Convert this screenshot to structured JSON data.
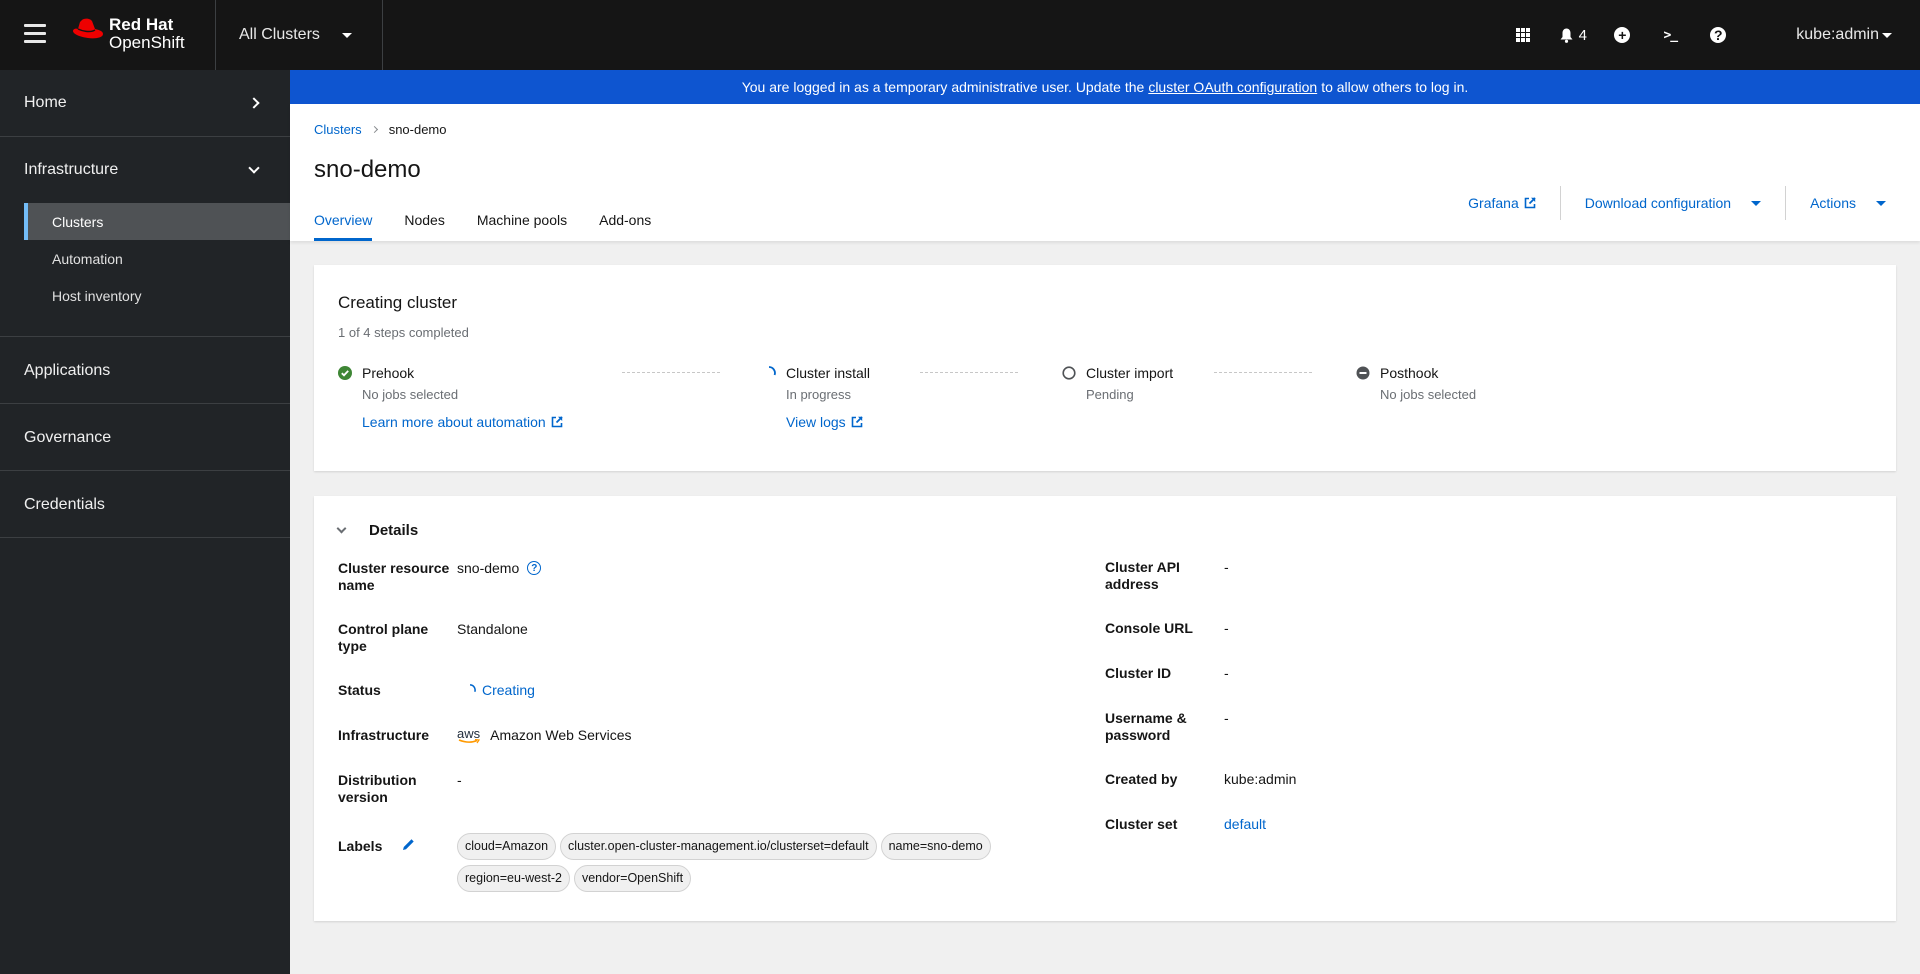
{
  "masthead": {
    "brand_line1": "Red Hat",
    "brand_line2": "OpenShift",
    "cluster_switcher": "All Clusters",
    "notifications_count": "4",
    "user": "kube:admin",
    "icons": [
      "app-launcher-icon",
      "bell-icon",
      "plus-circle-icon",
      "terminal-icon",
      "help-icon"
    ]
  },
  "sidebar": {
    "groups": [
      {
        "label": "Home",
        "expanded": false
      },
      {
        "label": "Infrastructure",
        "expanded": true,
        "items": [
          {
            "label": "Clusters",
            "active": true
          },
          {
            "label": "Automation",
            "active": false
          },
          {
            "label": "Host inventory",
            "active": false
          }
        ]
      },
      {
        "label": "Applications",
        "expanded": false
      },
      {
        "label": "Governance",
        "expanded": false
      },
      {
        "label": "Credentials",
        "expanded": false
      }
    ]
  },
  "banner": {
    "text_before": "You are logged in as a temporary administrative user. Update the",
    "link": "cluster OAuth configuration",
    "text_after": "to allow others to log in.",
    "color": "#0e55d0"
  },
  "page": {
    "breadcrumb": [
      {
        "label": "Clusters"
      },
      {
        "label": "sno-demo"
      }
    ],
    "title": "sno-demo",
    "tabs": [
      {
        "label": "Overview",
        "active": true
      },
      {
        "label": "Nodes",
        "active": false
      },
      {
        "label": "Machine pools",
        "active": false
      },
      {
        "label": "Add-ons",
        "active": false
      }
    ],
    "actions": {
      "grafana": "Grafana",
      "download": "Download configuration",
      "actions": "Actions"
    }
  },
  "progress": {
    "title": "Creating cluster",
    "subtitle": "1 of 4 steps completed",
    "completed_steps": 1,
    "total_steps": 4,
    "steps": [
      {
        "name": "Prehook",
        "status": "complete",
        "desc": "No jobs selected",
        "link": "Learn more about automation"
      },
      {
        "name": "Cluster install",
        "status": "in-progress",
        "desc": "In progress",
        "link": "View logs"
      },
      {
        "name": "Cluster import",
        "status": "pending",
        "desc": "Pending"
      },
      {
        "name": "Posthook",
        "status": "skipped",
        "desc": "No jobs selected"
      }
    ]
  },
  "details": {
    "title": "Details",
    "left": [
      {
        "label": "Cluster resource name",
        "value": "sno-demo"
      },
      {
        "label": "Control plane type",
        "value": "Standalone"
      },
      {
        "label": "Status",
        "value": "Creating"
      },
      {
        "label": "Infrastructure",
        "value": "Amazon Web Services",
        "logo": "aws"
      },
      {
        "label": "Distribution version",
        "value": "-"
      },
      {
        "label": "Labels",
        "value": ""
      }
    ],
    "labels": [
      "cloud=Amazon",
      "cluster.open-cluster-management.io/clusterset=default",
      "name=sno-demo",
      "region=eu-west-2",
      "vendor=OpenShift"
    ],
    "right": [
      {
        "label": "Cluster API address",
        "value": "-"
      },
      {
        "label": "Console URL",
        "value": "-"
      },
      {
        "label": "Cluster ID",
        "value": "-"
      },
      {
        "label": "Username & password",
        "value": "-"
      },
      {
        "label": "Created by",
        "value": "kube:admin"
      },
      {
        "label": "Cluster set",
        "value": "default"
      }
    ]
  }
}
